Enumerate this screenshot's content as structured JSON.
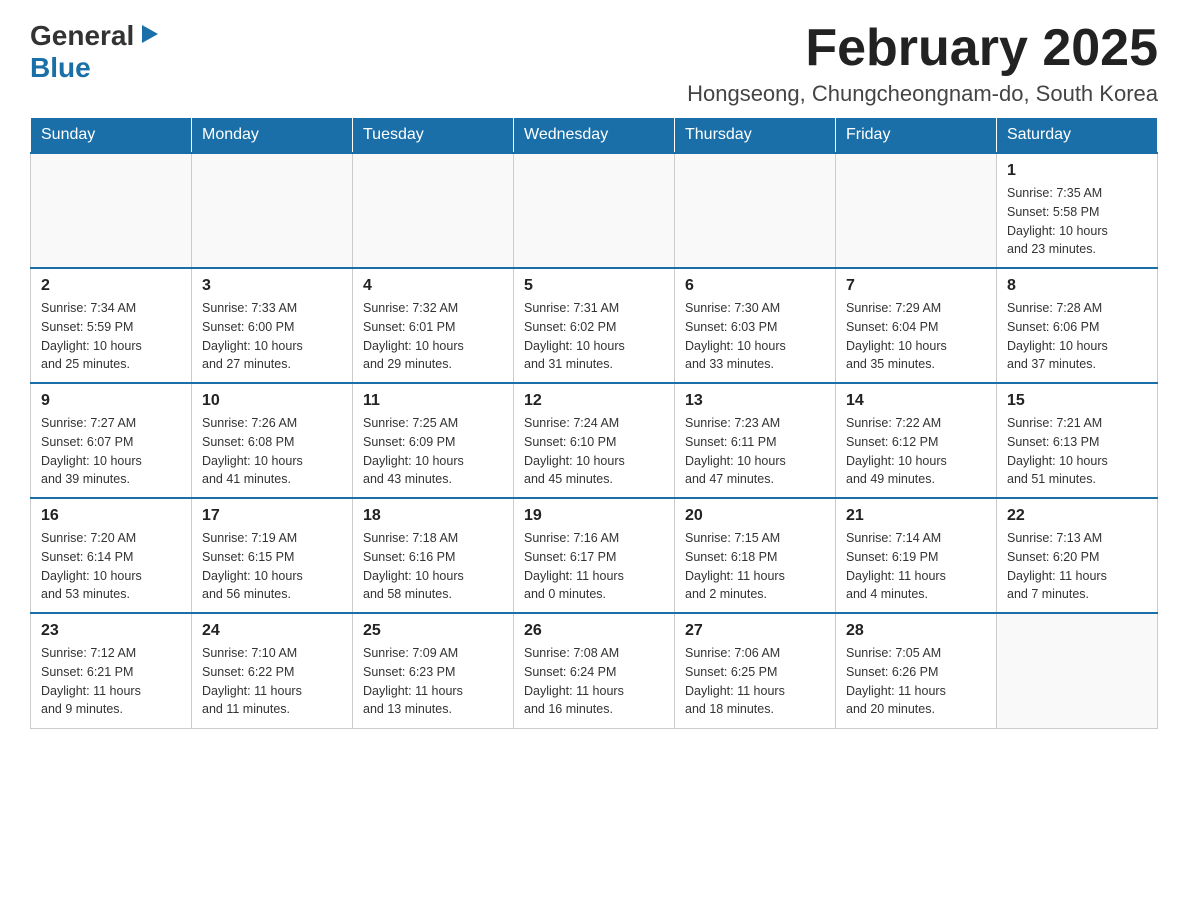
{
  "logo": {
    "general": "General",
    "blue": "Blue",
    "arrow": "▶"
  },
  "title": "February 2025",
  "location": "Hongseong, Chungcheongnam-do, South Korea",
  "days_of_week": [
    "Sunday",
    "Monday",
    "Tuesday",
    "Wednesday",
    "Thursday",
    "Friday",
    "Saturday"
  ],
  "weeks": [
    [
      {
        "day": "",
        "info": ""
      },
      {
        "day": "",
        "info": ""
      },
      {
        "day": "",
        "info": ""
      },
      {
        "day": "",
        "info": ""
      },
      {
        "day": "",
        "info": ""
      },
      {
        "day": "",
        "info": ""
      },
      {
        "day": "1",
        "info": "Sunrise: 7:35 AM\nSunset: 5:58 PM\nDaylight: 10 hours\nand 23 minutes."
      }
    ],
    [
      {
        "day": "2",
        "info": "Sunrise: 7:34 AM\nSunset: 5:59 PM\nDaylight: 10 hours\nand 25 minutes."
      },
      {
        "day": "3",
        "info": "Sunrise: 7:33 AM\nSunset: 6:00 PM\nDaylight: 10 hours\nand 27 minutes."
      },
      {
        "day": "4",
        "info": "Sunrise: 7:32 AM\nSunset: 6:01 PM\nDaylight: 10 hours\nand 29 minutes."
      },
      {
        "day": "5",
        "info": "Sunrise: 7:31 AM\nSunset: 6:02 PM\nDaylight: 10 hours\nand 31 minutes."
      },
      {
        "day": "6",
        "info": "Sunrise: 7:30 AM\nSunset: 6:03 PM\nDaylight: 10 hours\nand 33 minutes."
      },
      {
        "day": "7",
        "info": "Sunrise: 7:29 AM\nSunset: 6:04 PM\nDaylight: 10 hours\nand 35 minutes."
      },
      {
        "day": "8",
        "info": "Sunrise: 7:28 AM\nSunset: 6:06 PM\nDaylight: 10 hours\nand 37 minutes."
      }
    ],
    [
      {
        "day": "9",
        "info": "Sunrise: 7:27 AM\nSunset: 6:07 PM\nDaylight: 10 hours\nand 39 minutes."
      },
      {
        "day": "10",
        "info": "Sunrise: 7:26 AM\nSunset: 6:08 PM\nDaylight: 10 hours\nand 41 minutes."
      },
      {
        "day": "11",
        "info": "Sunrise: 7:25 AM\nSunset: 6:09 PM\nDaylight: 10 hours\nand 43 minutes."
      },
      {
        "day": "12",
        "info": "Sunrise: 7:24 AM\nSunset: 6:10 PM\nDaylight: 10 hours\nand 45 minutes."
      },
      {
        "day": "13",
        "info": "Sunrise: 7:23 AM\nSunset: 6:11 PM\nDaylight: 10 hours\nand 47 minutes."
      },
      {
        "day": "14",
        "info": "Sunrise: 7:22 AM\nSunset: 6:12 PM\nDaylight: 10 hours\nand 49 minutes."
      },
      {
        "day": "15",
        "info": "Sunrise: 7:21 AM\nSunset: 6:13 PM\nDaylight: 10 hours\nand 51 minutes."
      }
    ],
    [
      {
        "day": "16",
        "info": "Sunrise: 7:20 AM\nSunset: 6:14 PM\nDaylight: 10 hours\nand 53 minutes."
      },
      {
        "day": "17",
        "info": "Sunrise: 7:19 AM\nSunset: 6:15 PM\nDaylight: 10 hours\nand 56 minutes."
      },
      {
        "day": "18",
        "info": "Sunrise: 7:18 AM\nSunset: 6:16 PM\nDaylight: 10 hours\nand 58 minutes."
      },
      {
        "day": "19",
        "info": "Sunrise: 7:16 AM\nSunset: 6:17 PM\nDaylight: 11 hours\nand 0 minutes."
      },
      {
        "day": "20",
        "info": "Sunrise: 7:15 AM\nSunset: 6:18 PM\nDaylight: 11 hours\nand 2 minutes."
      },
      {
        "day": "21",
        "info": "Sunrise: 7:14 AM\nSunset: 6:19 PM\nDaylight: 11 hours\nand 4 minutes."
      },
      {
        "day": "22",
        "info": "Sunrise: 7:13 AM\nSunset: 6:20 PM\nDaylight: 11 hours\nand 7 minutes."
      }
    ],
    [
      {
        "day": "23",
        "info": "Sunrise: 7:12 AM\nSunset: 6:21 PM\nDaylight: 11 hours\nand 9 minutes."
      },
      {
        "day": "24",
        "info": "Sunrise: 7:10 AM\nSunset: 6:22 PM\nDaylight: 11 hours\nand 11 minutes."
      },
      {
        "day": "25",
        "info": "Sunrise: 7:09 AM\nSunset: 6:23 PM\nDaylight: 11 hours\nand 13 minutes."
      },
      {
        "day": "26",
        "info": "Sunrise: 7:08 AM\nSunset: 6:24 PM\nDaylight: 11 hours\nand 16 minutes."
      },
      {
        "day": "27",
        "info": "Sunrise: 7:06 AM\nSunset: 6:25 PM\nDaylight: 11 hours\nand 18 minutes."
      },
      {
        "day": "28",
        "info": "Sunrise: 7:05 AM\nSunset: 6:26 PM\nDaylight: 11 hours\nand 20 minutes."
      },
      {
        "day": "",
        "info": ""
      }
    ]
  ]
}
